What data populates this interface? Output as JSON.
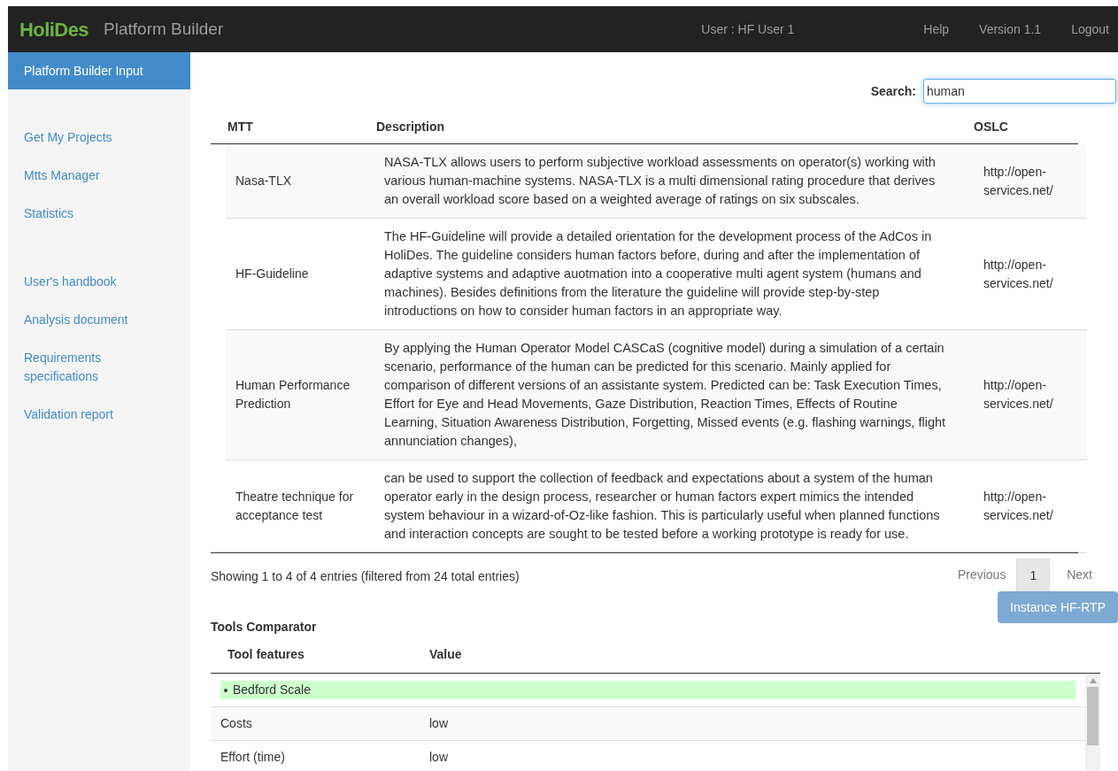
{
  "header": {
    "logo": "HoliDes",
    "title": "Platform Builder",
    "user": "User : HF User 1",
    "links": [
      "Help",
      "Version 1.1",
      "Logout"
    ]
  },
  "sidebar": {
    "active": "Platform Builder Input",
    "groups": [
      [
        "Get My Projects",
        "Mtts Manager",
        "Statistics"
      ],
      [
        "User's handbook",
        "Analysis document",
        "Requirements specifications",
        "Validation report"
      ]
    ]
  },
  "search": {
    "label": "Search:",
    "value": "human"
  },
  "table": {
    "columns": [
      "MTT",
      "Description",
      "OSLC"
    ],
    "rows": [
      {
        "mtt": "Nasa-TLX",
        "description": "NASA-TLX allows users to perform subjective workload assessments on operator(s) working with various human-machine systems. NASA-TLX is a multi dimensional rating procedure that derives an overall workload score based on a weighted average of ratings on six subscales.",
        "oslc": "http://open-services.net/"
      },
      {
        "mtt": "HF-Guideline",
        "description": "The HF-Guideline will provide a detailed orientation for the development process of the AdCos in HoliDes. The guideline considers human factors before, during and after the implementation of adaptive systems and adaptive auotmation into a cooperative multi agent system (humans and machines). Besides definitions from the literature the guideline will provide step-by-step introductions on how to consider human factors in an appropriate way.",
        "oslc": "http://open-services.net/"
      },
      {
        "mtt": "Human Performance Prediction",
        "description": "By applying the Human Operator Model CASCaS (cognitive model) during a simulation of a certain scenario, performance of the human can be predicted for this scenario. Mainly applied for comparison of different versions of an assistante system. Predicted can be: Task Execution Times, Effort for Eye and Head Movements, Gaze Distribution, Reaction Times, Effects of Routine Learning, Situation Awareness Distribution, Forgetting, Missed events (e.g. flashing warnings, flight annunciation changes),",
        "oslc": "http://open-services.net/"
      },
      {
        "mtt": "Theatre technique for acceptance test",
        "description": "can be used to support the collection of feedback and expectations about a system of the human operator early in the design process, researcher or human factors expert mimics the intended system behaviour in a wizard-of-Oz-like fashion. This is particularly useful when planned functions and interaction concepts are sought to be tested before a working prototype is ready for use.",
        "oslc": "http://open-services.net/"
      }
    ]
  },
  "info": "Showing 1 to 4 of 4 entries (filtered from 24 total entries)",
  "pagination": {
    "previous": "Previous",
    "pages": [
      {
        "label": "1",
        "selected": true
      }
    ],
    "next": "Next"
  },
  "instance_button": "Instance HF-RTP",
  "comparator": {
    "title": "Tools Comparator",
    "columns": [
      "Tool features",
      "Value"
    ],
    "group": "Bedford Scale",
    "rows": [
      {
        "feature": "Costs",
        "value": "low"
      },
      {
        "feature": "Effort (time)",
        "value": "low"
      }
    ]
  }
}
